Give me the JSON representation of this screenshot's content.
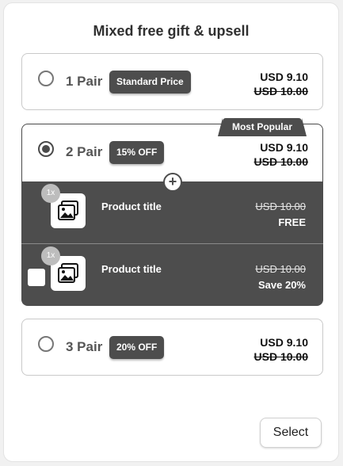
{
  "widget": {
    "title": "Mixed free gift & upsell"
  },
  "options": [
    {
      "quantity": "1 Pair",
      "badge": "Standard Price",
      "price": "USD 9.10",
      "compare_price": "USD 10.00",
      "selected": false
    },
    {
      "quantity": "2 Pair",
      "badge": "15% OFF",
      "price": "USD 9.10",
      "compare_price": "USD 10.00",
      "selected": true,
      "ribbon": "Most Popular"
    },
    {
      "quantity": "3 Pair",
      "badge": "20% OFF",
      "price": "USD 9.10",
      "compare_price": "USD 10.00",
      "selected": false
    }
  ],
  "gifts": [
    {
      "qty": "1x",
      "title": "Product title",
      "compare_price": "USD 10.00",
      "status": "FREE",
      "checkbox": false,
      "icon": "image-icon"
    },
    {
      "qty": "1x",
      "title": "Product title",
      "compare_price": "USD 10.00",
      "status": "Save 20%",
      "checkbox": true,
      "checked": false,
      "icon": "image-icon"
    }
  ],
  "plus_icon": "+",
  "actions": {
    "select_label": "Select"
  },
  "colors": {
    "dark": "#4d4d4d",
    "border": "#c9c9c9",
    "background": "#f1f1f1"
  }
}
